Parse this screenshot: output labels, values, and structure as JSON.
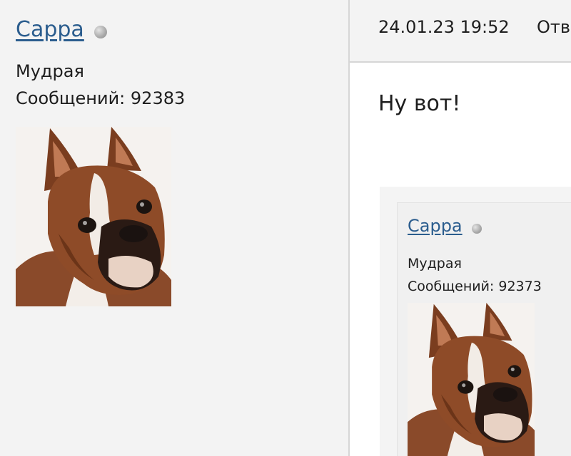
{
  "author": {
    "name": "Сарра",
    "status": "offline",
    "rank": "Мудрая",
    "posts_label": "Сообщений: 92383",
    "avatar": "boxer-dog-avatar"
  },
  "post": {
    "date": "24.01.23 19:52",
    "reply_label": "Отв",
    "text": "Ну вот!"
  },
  "quote": {
    "author": {
      "name": "Сарра",
      "status": "offline",
      "rank": "Мудрая",
      "posts_label": "Сообщений: 92373",
      "avatar": "boxer-dog-avatar"
    }
  },
  "colors": {
    "link": "#2b5d8e",
    "background": "#f3f3f3",
    "post_background": "#ffffff",
    "divider": "#d6d6d6"
  }
}
